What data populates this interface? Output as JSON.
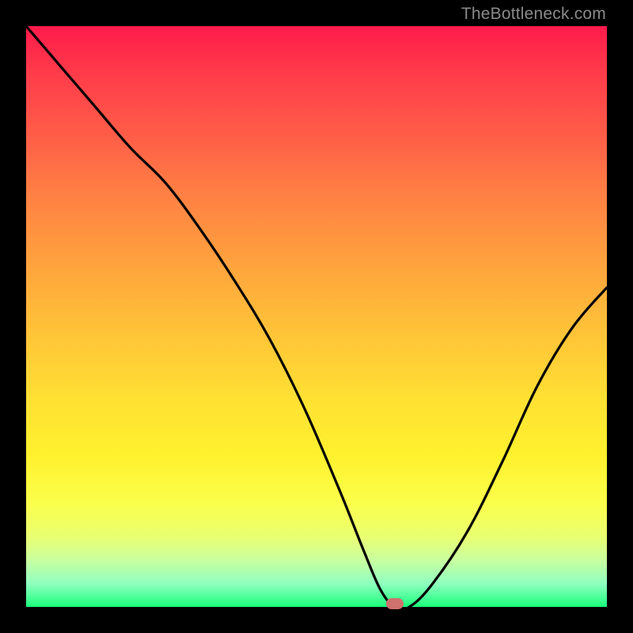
{
  "watermark": "TheBottleneck.com",
  "marker": {
    "color": "#cf716d",
    "x_pct": 63.5,
    "y_pct": 99.4
  },
  "chart_data": {
    "type": "line",
    "title": "",
    "xlabel": "",
    "ylabel": "",
    "xlim": [
      0,
      100
    ],
    "ylim": [
      0,
      100
    ],
    "grid": false,
    "legend": false,
    "series": [
      {
        "name": "bottleneck-curve",
        "color": "#000000",
        "x": [
          0,
          6,
          12,
          18,
          24,
          30,
          36,
          42,
          48,
          54,
          58,
          61,
          63.5,
          66,
          70,
          76,
          82,
          88,
          94,
          100
        ],
        "y": [
          100,
          93,
          86,
          79,
          73,
          65,
          56,
          46,
          34,
          20,
          10,
          3,
          0,
          0,
          4,
          13,
          25,
          38,
          48,
          55
        ]
      }
    ],
    "annotations": [
      {
        "type": "marker",
        "x": 63.5,
        "y": 0,
        "shape": "rounded-rect",
        "color": "#cf716d"
      }
    ],
    "background_gradient": {
      "direction": "top-to-bottom",
      "stops": [
        {
          "pct": 0,
          "color": "#ff1a4b"
        },
        {
          "pct": 40,
          "color": "#ffa03e"
        },
        {
          "pct": 74,
          "color": "#fff12e"
        },
        {
          "pct": 100,
          "color": "#1aff7b"
        }
      ]
    }
  }
}
